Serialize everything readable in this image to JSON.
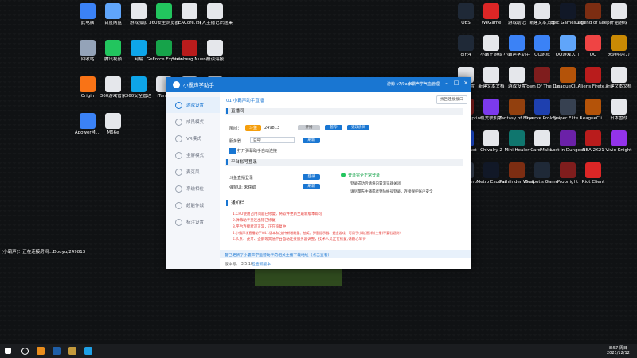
{
  "desktop_left": [
    {
      "label": "此电脑",
      "color": "#3b82f6"
    },
    {
      "label": "百度网盘",
      "color": "#60a5fa"
    },
    {
      "label": "游戏加加",
      "color": "#e5e7eb"
    },
    {
      "label": "360安全浏览器",
      "color": "#22c55e"
    },
    {
      "label": "EACore.ini",
      "color": "#e5e7eb"
    },
    {
      "label": "斗大主播记识题集",
      "color": "#e5e7eb"
    },
    {
      "label": "回收站",
      "color": "#94a3b8"
    },
    {
      "label": "腾讯视频",
      "color": "#22c55e"
    },
    {
      "label": "网易",
      "color": "#0ea5e9"
    },
    {
      "label": "GeForce Experience",
      "color": "#16a34a"
    },
    {
      "label": "Steinberg Nuendo 4",
      "color": "#b91c1c"
    },
    {
      "label": "报读海报",
      "color": "#e5e7eb"
    },
    {
      "label": "Origin",
      "color": "#f97316"
    },
    {
      "label": "360游戏管家",
      "color": "#e5e7eb"
    },
    {
      "label": "360安全管理",
      "color": "#0ea5e9"
    },
    {
      "label": "iTunes",
      "color": "#e5e7eb"
    },
    {
      "label": "MAYA新建文本文档",
      "color": "#e5e7eb"
    },
    {
      "label": "新建文本文档",
      "color": "#e5e7eb"
    },
    {
      "label": "ApowerMi...",
      "color": "#3b82f6"
    },
    {
      "label": "M66e",
      "color": "#e5e7eb"
    }
  ],
  "desktop_right": [
    {
      "label": "OBS",
      "color": "#1f2937"
    },
    {
      "label": "WeGame",
      "color": "#dc2626"
    },
    {
      "label": "游戏助记",
      "color": "#e5e7eb"
    },
    {
      "label": "新建文本文档",
      "color": "#e5e7eb"
    },
    {
      "label": "Epic Games Launcher",
      "color": "#111827"
    },
    {
      "label": "Legend of Keepers",
      "color": "#7c2d12"
    },
    {
      "label": "开始游戏",
      "color": "#e5e7eb"
    },
    {
      "label": "dirt4",
      "color": "#1f2937"
    },
    {
      "label": "小霸王游戏",
      "color": "#e5e7eb"
    },
    {
      "label": "小霸声学助手",
      "color": "#3b82f6"
    },
    {
      "label": "QQ游戏",
      "color": "#3b82f6"
    },
    {
      "label": "QQ游戏大厅",
      "color": "#60a5fa"
    },
    {
      "label": "QQ",
      "color": "#ef4444"
    },
    {
      "label": "天涯明月刀",
      "color": "#ca8a04"
    },
    {
      "label": "游戏设置",
      "color": "#e5e7eb"
    },
    {
      "label": "新建文本文档",
      "color": "#e5e7eb"
    },
    {
      "label": "游戏设置",
      "color": "#e5e7eb"
    },
    {
      "label": "Town Of The Dead",
      "color": "#7f1d1d"
    },
    {
      "label": "LeagueCli...",
      "color": "#b45309"
    },
    {
      "label": "Aliens Firete...",
      "color": "#b91c1c"
    },
    {
      "label": "新建文本文档",
      "color": "#e5e7eb"
    },
    {
      "label": "Dark Deception",
      "color": "#7f1d1d"
    },
    {
      "label": "饥荒联机版",
      "color": "#7c3aed"
    },
    {
      "label": "Fantasy of Expediti...",
      "color": "#92400e"
    },
    {
      "label": "Dwerve Prologue",
      "color": "#1e40af"
    },
    {
      "label": "Sniper Elite 4",
      "color": "#374151"
    },
    {
      "label": "LeagueCli...",
      "color": "#b45309"
    },
    {
      "label": "日本雪战",
      "color": "#e5e7eb"
    },
    {
      "label": "Battle.net",
      "color": "#1d4ed8"
    },
    {
      "label": "Chivalry 2",
      "color": "#e5e7eb"
    },
    {
      "label": "Mini Healer",
      "color": "#0f766e"
    },
    {
      "label": "CardMaker",
      "color": "#e5e7eb"
    },
    {
      "label": "Lost in Dungeon",
      "color": "#6b21a8"
    },
    {
      "label": "NBA 2K21",
      "color": "#b91c1c"
    },
    {
      "label": "Vivid Knight",
      "color": "#9333ea"
    },
    {
      "label": "Loop Hero",
      "color": "#374151"
    },
    {
      "label": "Metro Exodus",
      "color": "#111827"
    },
    {
      "label": "Pathfinder Wrath o...",
      "color": "#7c2d12"
    },
    {
      "label": "Despot's Game D...",
      "color": "#1f2937"
    },
    {
      "label": "Propnight",
      "color": "#7f1d1d"
    },
    {
      "label": "Riot Client",
      "color": "#dc2626"
    }
  ],
  "window": {
    "title": "小霸声学助手",
    "user": "游鲸 v7/9ad6",
    "user2": "小霸声学气血管理",
    "min": "–",
    "max": "□",
    "close": "×"
  },
  "sidebar": [
    {
      "label": "游戏设置"
    },
    {
      "label": "成员模式"
    },
    {
      "label": "VR模式"
    },
    {
      "label": "全屏模式"
    },
    {
      "label": "麦克风"
    },
    {
      "label": "系统相位"
    },
    {
      "label": "超能作战"
    },
    {
      "label": "标注设置"
    }
  ],
  "main": {
    "header": "01  小霸声助手直播",
    "header_btn": "找回连接接口",
    "section_live": "直播间",
    "room_label": "房间：",
    "room_brand": "斗鱼",
    "room_id": "249813",
    "btn_grey": "开播",
    "btn_start": "暂停",
    "btn_update": "更改房间",
    "server_label": "服务器",
    "server_value": "自动",
    "server_btn": "刷新",
    "checkbox_label": "打开弹幕助手自动连接",
    "section_account": "平台帐号登录",
    "account1_label": "斗鱼直播登录",
    "account1_btn": "登录",
    "account2_label": "弹窗UI: 未获取",
    "account2_btn": "刷新",
    "account_info1": "登录完全正常登录",
    "account_info2": "登录成功后请将内置浏览器关闭",
    "account_info3": "请尽量先主播或者登陆帐号登录，连接保护账户安全",
    "section_notice": "通知栏",
    "notices": [
      "1.CPU使用占用问题已修复，将软件更新至最新版本即可",
      "2.弹幕助手重连出错已修复",
      "3.平台连接状况正常，正在恢复中",
      "4.小霸声学直播助手V4.1版本和(支持新增刷量、抽奖、弹窗提示器、掘金游戏）可用于小助(画)和(主播)不要验证刷！",
      "5.头条、虎牙、企鹅等其他平台自动连接服务器调整，技术人员正在恢复,请耐心等待"
    ],
    "footer_notice": "警己更新了小霸声学运营助手的相关主播下载地址（点击查看）",
    "version": "版本号： 3.5.10",
    "version_link": "检查新版本"
  },
  "overlay_text": "[小霸声]：正在连接房间...Douyu/249813",
  "taskbar": {
    "time": "8:57 周日",
    "date": "2021/12/12"
  }
}
